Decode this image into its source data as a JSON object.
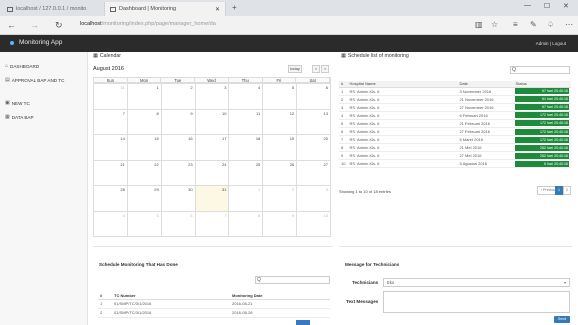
{
  "browser": {
    "tab_inactive": "localhost / 127.0.0.1 / monito",
    "tab_active": "Dashboard | Monitoring",
    "new_tab": "+",
    "url_host": "localhost",
    "url_path": "/monitoring/index.php/page/manager_home/da"
  },
  "app": {
    "title": "Monitoring App",
    "user_link": "Admin | Logout"
  },
  "sidebar": {
    "items": [
      {
        "label": "DASHBOARD"
      },
      {
        "label": "APPROVAL BAP AND TC"
      },
      {
        "label": "NEW TC"
      },
      {
        "label": "DATA BAP"
      }
    ]
  },
  "calendar": {
    "panel_title": "Calendar",
    "month": "August 2016",
    "today_btn": "today",
    "prev_btn": "<",
    "next_btn": ">",
    "weekdays": [
      "Sun",
      "Mon",
      "Tue",
      "Wed",
      "Thu",
      "Fri",
      "Sat"
    ],
    "days": [
      "31",
      "1",
      "2",
      "3",
      "4",
      "5",
      "6",
      "7",
      "8",
      "9",
      "10",
      "11",
      "12",
      "13",
      "14",
      "15",
      "16",
      "17",
      "18",
      "19",
      "20",
      "21",
      "22",
      "23",
      "24",
      "25",
      "26",
      "27",
      "28",
      "29",
      "30",
      "31",
      "1",
      "2",
      "3",
      "4",
      "5",
      "6",
      "7",
      "8",
      "9",
      "10"
    ]
  },
  "schedule_list": {
    "panel_title": "Schedule list of monitoring",
    "search_value": "Q",
    "columns": [
      "#",
      "Hospital Name",
      "Date",
      "Status"
    ],
    "rows": [
      {
        "no": "1",
        "name": "RS. Admin Kls. 6",
        "date": "3 November 2016",
        "status": "67 hari 20:40:16"
      },
      {
        "no": "2",
        "name": "RS. Admin Kls. 6",
        "date": "21 November 2016",
        "status": "61 hari 20:40:16"
      },
      {
        "no": "3",
        "name": "RS. Admin Kls. 6",
        "date": "27 November 2016",
        "status": "67 hari 20:40:16"
      },
      {
        "no": "4",
        "name": "RS. Admin Kls. 6",
        "date": "6 Februari 2016",
        "status": "172 hari 20:40:16"
      },
      {
        "no": "5",
        "name": "RS. Admin Kls. 6",
        "date": "21 Februari 2016",
        "status": "172 hari 20:40:16"
      },
      {
        "no": "6",
        "name": "RS. Admin Kls. 6",
        "date": "27 Februari 2016",
        "status": "172 hari 20:40:16"
      },
      {
        "no": "7",
        "name": "RS. Admin Kls. 6",
        "date": "5 Maret 2016",
        "status": "172 hari 20:40:16"
      },
      {
        "no": "8",
        "name": "RS. Admin Kls. 6",
        "date": "21 Mei 2016",
        "status": "262 hari 20:40:16"
      },
      {
        "no": "9",
        "name": "RS. Admin Kls. 6",
        "date": "27 Mei 2016",
        "status": "262 hari 20:40:16"
      },
      {
        "no": "10",
        "name": "RS. Admin Kls. 6",
        "date": "5 Agustus 2016",
        "status": "6 hari 20:40:16"
      }
    ],
    "showing": "Showing 1 to 10 of 18 entries",
    "prev_label": "‹ Previous",
    "pages": [
      "1",
      "2"
    ],
    "next_label": "Next ›"
  },
  "monitoring_done": {
    "panel_title": "Schedule Monitoring That Has Done",
    "search_value": "Q",
    "columns": [
      "#",
      "TC Number",
      "Monitoring Date"
    ],
    "rows": [
      {
        "no": "1",
        "tc": "01/SMP/TC/3/1/2016",
        "date": "2016-08-21"
      },
      {
        "no": "2",
        "tc": "01/SMP/TC/3/1/2016",
        "date": "2016-08-28"
      }
    ]
  },
  "message_form": {
    "panel_title": "Message for Technicians",
    "technicians_label": "Technicians",
    "technicians_value": "Eko",
    "text_label": "Text Messages",
    "send_label": "Send"
  },
  "colors": {
    "app_header": "#2b2b2b",
    "status_green": "#1e8a3c",
    "primary_blue": "#337ab7",
    "today_highlight": "#fcf8e3"
  }
}
